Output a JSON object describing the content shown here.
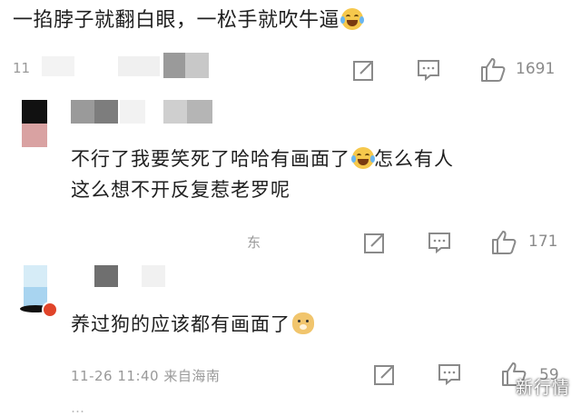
{
  "thread": {
    "top_comment": {
      "text": "一掐脖子就翻白眼，一松手就吹牛逼",
      "meta": "11",
      "like_count": "1691"
    },
    "replies": [
      {
        "text_line1": "不行了我要笑死了哈哈有画面了",
        "text_line2": "怎么有人",
        "text_line3": "这么想不开反复惹老罗呢",
        "meta": "东",
        "like_count": "171"
      },
      {
        "text": "养过狗的应该都有画面了",
        "meta": "11-26 11:40 来自海南",
        "like_count": "59"
      }
    ],
    "footer_peek": "…"
  },
  "watermark": "新行情",
  "colors": {
    "text": "#1f1f1f",
    "meta": "#999999",
    "icon": "#8a8a8a"
  },
  "icons": [
    "emoji-laugh-tears-icon",
    "share-icon",
    "comment-icon",
    "like-icon",
    "dog-emoji-icon"
  ]
}
